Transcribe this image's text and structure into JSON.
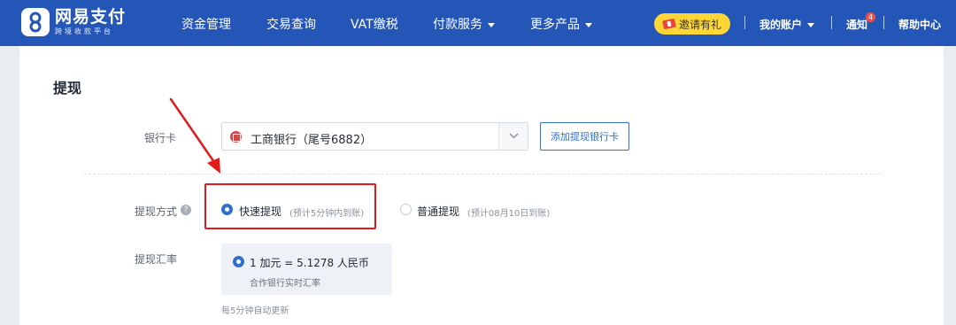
{
  "header": {
    "logo": {
      "name": "网易支付",
      "tagline": "跨境收款平台"
    },
    "nav": [
      {
        "label": "资金管理"
      },
      {
        "label": "交易查询"
      },
      {
        "label": "VAT缴税"
      },
      {
        "label": "付款服务"
      },
      {
        "label": "更多产品"
      }
    ],
    "invite_label": "邀请有礼",
    "account_label": "我的账户",
    "notify_label": "通知",
    "notify_count": "4",
    "help_label": "帮助中心"
  },
  "page": {
    "title": "提现",
    "bank_card": {
      "label": "银行卡",
      "selected": "工商银行（尾号6882）",
      "add_button": "添加提现银行卡"
    },
    "method": {
      "label": "提现方式",
      "options": [
        {
          "title": "快速提现",
          "hint": "(预计5分钟内到账)",
          "selected": true
        },
        {
          "title": "普通提现",
          "hint": "(预计08月10日到账)",
          "selected": false
        }
      ]
    },
    "rate": {
      "label": "提现汇率",
      "value": "1 加元 = 5.1278 人民币",
      "source": "合作银行实时汇率",
      "refresh_note": "每5分钟自动更新"
    }
  },
  "colors": {
    "nav_bg": "#2456b8",
    "accent": "#2f6fd0",
    "highlight": "#e21a1a",
    "invite_bg": "#ffd633"
  }
}
